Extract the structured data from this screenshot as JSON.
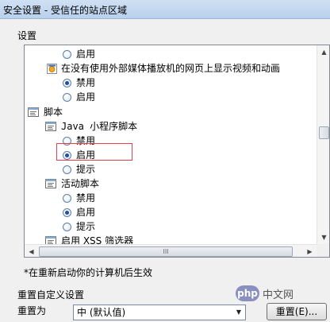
{
  "window": {
    "title": "安全设置 - 受信任的站点区域"
  },
  "settings": {
    "group_label": "设置",
    "rows": [
      {
        "label": "启用",
        "kind": "radio",
        "checked": false
      },
      {
        "label": "在没有使用外部媒体播放机的网页上显示视频和动画",
        "kind": "setting",
        "icon": "setting-icon"
      },
      {
        "label": "禁用",
        "kind": "radio",
        "checked": true
      },
      {
        "label": "启用",
        "kind": "radio",
        "checked": false
      },
      {
        "label": "脚本",
        "kind": "category",
        "icon": "script-icon"
      },
      {
        "label": "Java 小程序脚本",
        "kind": "setting",
        "icon": "script-icon"
      },
      {
        "label": "禁用",
        "kind": "radio",
        "checked": false
      },
      {
        "label": "启用",
        "kind": "radio",
        "checked": true
      },
      {
        "label": "提示",
        "kind": "radio",
        "checked": false
      },
      {
        "label": "活动脚本",
        "kind": "setting",
        "icon": "script-icon"
      },
      {
        "label": "禁用",
        "kind": "radio",
        "checked": false
      },
      {
        "label": "启用",
        "kind": "radio",
        "checked": true
      },
      {
        "label": "提示",
        "kind": "radio",
        "checked": false
      },
      {
        "label": "启用 XSS 筛选器",
        "kind": "setting",
        "icon": "script-icon"
      }
    ],
    "hscroll_grip": "III"
  },
  "note": "*在重新启动你的计算机后生效",
  "reset": {
    "group_label": "重置自定义设置",
    "label": "重置为",
    "selected": "中 (默认值)",
    "button_label": "重置(E)..."
  },
  "watermark": {
    "logo": "php",
    "text": "中文网"
  },
  "colors": {
    "highlight": "#e0444a",
    "radio_dot": "#1c4f9c"
  }
}
